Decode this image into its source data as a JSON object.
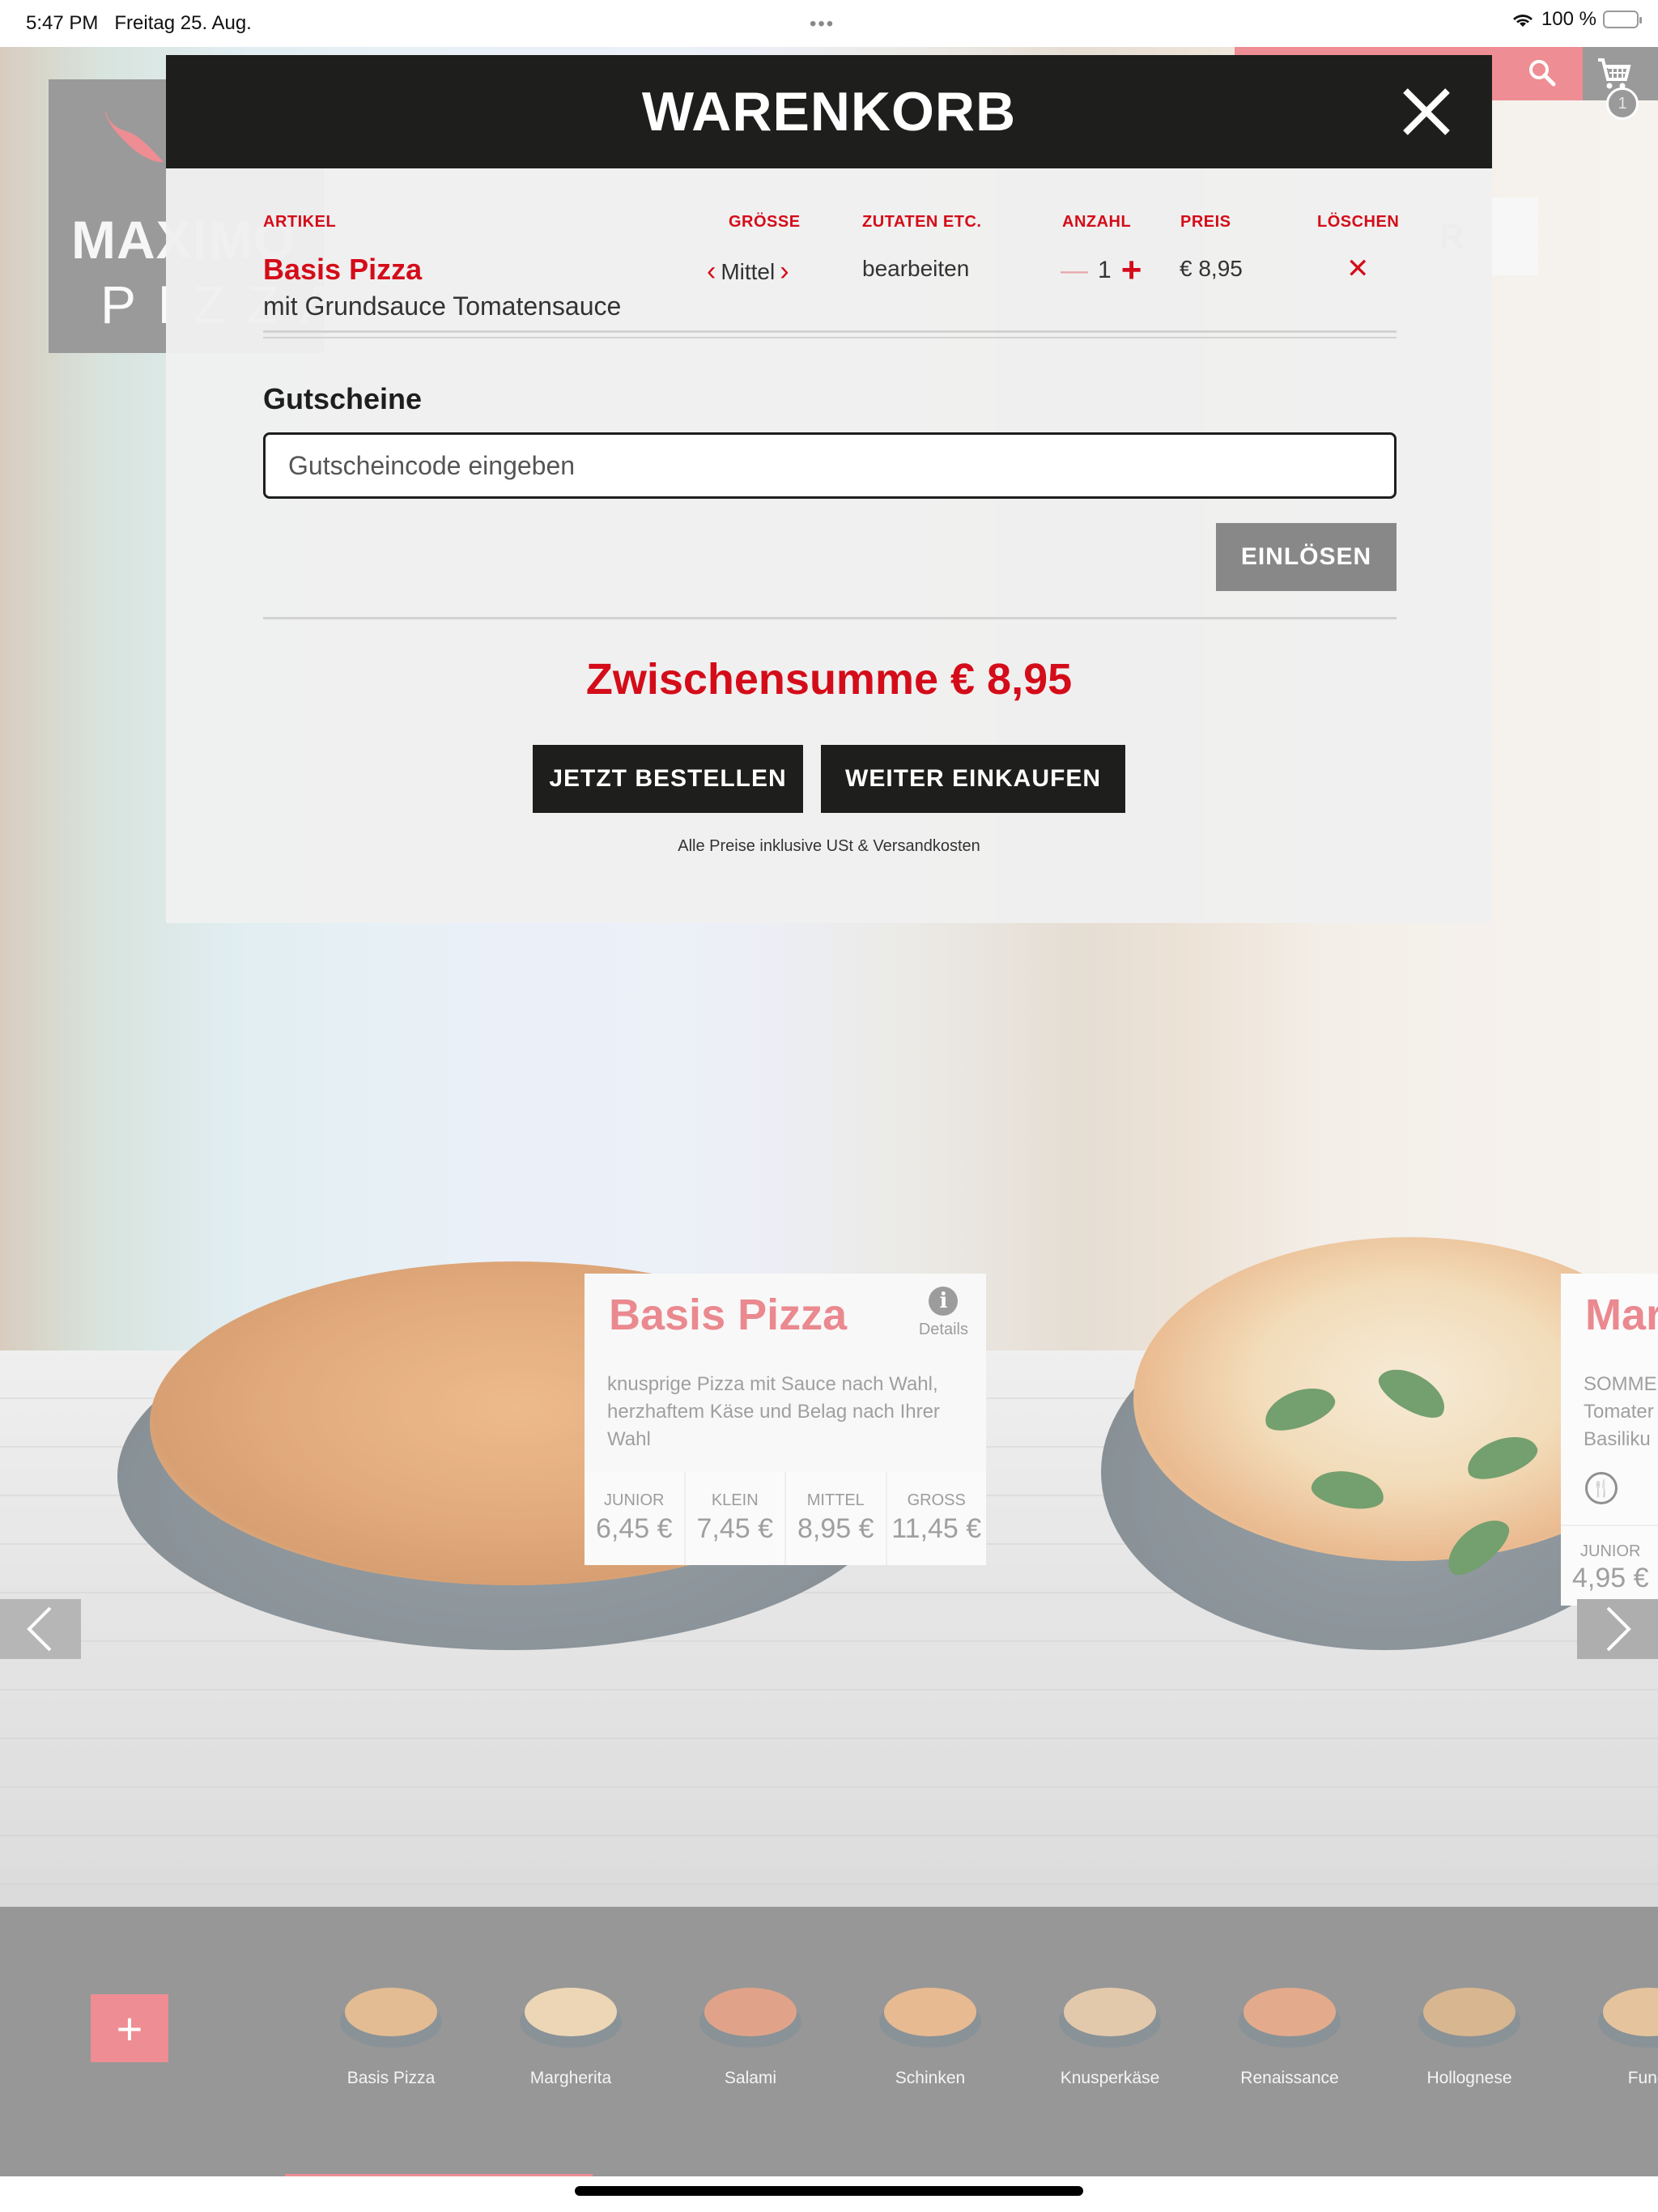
{
  "status_bar": {
    "time": "5:47 PM",
    "date": "Freitag 25. Aug.",
    "dots": "•••",
    "battery": "100 %",
    "wifi_icon": "wifi-icon",
    "battery_icon": "battery-icon"
  },
  "header": {
    "logo_line1": "MAXIMO",
    "logo_line2": "PIZZA",
    "nav_visible_fragment": "R",
    "cart_count": "1",
    "search_icon": "search-icon",
    "cart_icon": "cart-icon"
  },
  "cart_modal": {
    "title": "WARENKORB",
    "close_icon": "close-icon",
    "columns": {
      "article": "ARTIKEL",
      "size": "GRÖSSE",
      "ingredients": "ZUTATEN ETC.",
      "quantity": "ANZAHL",
      "price": "PREIS",
      "delete": "LÖSCHEN"
    },
    "items": [
      {
        "name": "Basis Pizza",
        "subtitle": "mit Grundsauce Tomatensauce",
        "size": "Mittel",
        "edit_label": "bearbeiten",
        "quantity": "1",
        "minus": "—",
        "plus": "+",
        "price": "€ 8,95",
        "delete_symbol": "✕"
      }
    ],
    "voucher": {
      "label": "Gutscheine",
      "placeholder": "Gutscheincode eingeben",
      "value": "",
      "redeem_label": "EINLÖSEN"
    },
    "subtotal": "Zwischensumme € 8,95",
    "order_label": "JETZT BESTELLEN",
    "continue_label": "WEITER EINKAUFEN",
    "tax_note": "Alle Preise inklusive USt & Versandkosten"
  },
  "products": [
    {
      "name": "Basis Pizza",
      "details_label": "Details",
      "description": "knusprige Pizza mit Sauce nach Wahl, herzhaftem Käse und Belag nach Ihrer Wahl",
      "prices": [
        {
          "size": "JUNIOR",
          "price": "6,45 €"
        },
        {
          "size": "KLEIN",
          "price": "7,45 €"
        },
        {
          "size": "MITTEL",
          "price": "8,95 €"
        },
        {
          "size": "GROSS",
          "price": "11,45 €"
        }
      ]
    },
    {
      "name": "Mar",
      "description": "SOMME\nTomater\nBasiliku",
      "prices": [
        {
          "size": "JUNIOR",
          "price": "4,95 €"
        }
      ]
    }
  ],
  "bottom_bar": {
    "add_symbol": "+",
    "thumbnails": [
      {
        "label": "Basis Pizza",
        "color": "#d9a36a"
      },
      {
        "label": "Margherita",
        "color": "#e7c79a"
      },
      {
        "label": "Salami",
        "color": "#d4805c"
      },
      {
        "label": "Schinken",
        "color": "#dea068"
      },
      {
        "label": "Knusperkäse",
        "color": "#d8b48c"
      },
      {
        "label": "Renaissance",
        "color": "#d88a60"
      },
      {
        "label": "Hollognese",
        "color": "#c99a64"
      },
      {
        "label": "Fungi",
        "color": "#dcae78"
      }
    ]
  },
  "colors": {
    "accent_red": "#d40c19",
    "brand_coral": "#e8626a",
    "dark": "#1e1e1c",
    "gray_button": "#888888"
  }
}
